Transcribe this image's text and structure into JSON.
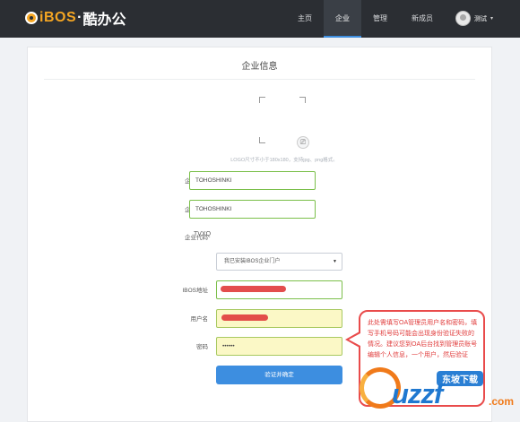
{
  "brand": {
    "logo_latin": "iBOS",
    "logo_dot": "·",
    "logo_cn": "酷办公"
  },
  "nav": [
    {
      "label": "主页",
      "active": false
    },
    {
      "label": "企业",
      "active": true
    },
    {
      "label": "管理",
      "active": false
    },
    {
      "label": "新成员",
      "active": false
    }
  ],
  "user": {
    "name": "测试",
    "caret": "▾"
  },
  "page": {
    "title": "企业信息"
  },
  "logo_upload": {
    "edit_icon": "⎚",
    "hint": "LOGO尺寸不小于180x180，支持jpg、png格式。"
  },
  "form": {
    "short_name": {
      "label": "企业简称",
      "value": "TOHOSHINKI"
    },
    "full_name": {
      "label": "企业全称",
      "value": "TOHOSHINKI"
    },
    "code": {
      "label": "企业代码",
      "value": "TVXQ"
    },
    "install_select": {
      "value": "我已安装IBOS企业门户",
      "caret": "▼"
    },
    "ibos_url": {
      "label": "IBOS地址",
      "value": ""
    },
    "username": {
      "label": "用户名",
      "value": ""
    },
    "password": {
      "label": "密码",
      "value": "••••••"
    },
    "submit_label": "验证并确定"
  },
  "callout": {
    "text": "此处需填写OA管理员用户名和密码，填写手机号码可能会出现身份验证失败的情况。建议您到OA后台找到管理员账号编辑个人信息，一个用户，然后验证"
  },
  "watermark": {
    "tag": "东坡下载",
    "brand": "uzzf",
    "tld": ".com"
  },
  "colors": {
    "topbar": "#2b2e33",
    "accent": "#3d8ee0",
    "logo": "#f5a623",
    "callout_red": "#e03a3a",
    "input_ok": "#7bbf4a"
  }
}
